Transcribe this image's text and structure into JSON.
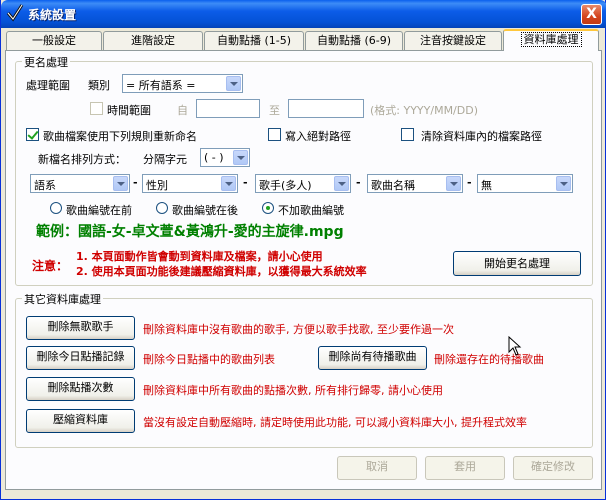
{
  "window": {
    "title": "系統設置",
    "close_label": "X"
  },
  "tabs": [
    {
      "label": "一般設定"
    },
    {
      "label": "進階設定"
    },
    {
      "label": "自動點播 (1-5)"
    },
    {
      "label": "自動點播 (6-9)"
    },
    {
      "label": "注音按鍵設定"
    },
    {
      "label": "資料庫處理"
    }
  ],
  "rename_group": {
    "title": "更名處理",
    "scope_label": "處理範圍",
    "category_label": "類別",
    "category_value": "= 所有語系 =",
    "time_range_label": "時間範圍",
    "from_label": "自",
    "to_label": "至",
    "from_value": "",
    "to_value": "",
    "format_hint": "(格式: YYYY/MM/DD)",
    "rename_rule_label": "歌曲檔案使用下列規則重新命名",
    "absolute_path_label": "寫入絕對路徑",
    "clear_path_label": "清除資料庫內的檔案路徑",
    "order_label": "新檔名排列方式：",
    "separator_label": "分隔字元",
    "separator_value": "( - )",
    "fields": [
      "語系",
      "性別",
      "歌手(多人)",
      "歌曲名稱",
      "無"
    ],
    "dash": "-",
    "number_options": [
      "歌曲編號在前",
      "歌曲編號在後",
      "不加歌曲編號"
    ],
    "example": "範例：國語-女-卓文萱&黃鴻升-愛的主旋律.mpg",
    "notice_label": "注意：",
    "notice_lines": [
      "1. 本頁面動作皆會動到資料庫及檔案，請小心使用",
      "2. 使用本頁面功能後建議壓縮資料庫，以獲得最大系統效率"
    ],
    "start_button": "開始更名處理"
  },
  "other_group": {
    "title": "其它資料庫處理",
    "delete_no_song_singer_button": "刪除無歌歌手",
    "delete_no_song_singer_desc": "刪除資料庫中沒有歌曲的歌手, 方便以歌手找歌, 至少要作過一次",
    "delete_today_records_button": "刪除今日點播記錄",
    "delete_today_records_desc": "刪除今日點播中的歌曲列表",
    "delete_pending_button": "刪除尚有待播歌曲",
    "delete_pending_desc": "刪除還存在的待播歌曲",
    "delete_play_count_button": "刪除點播次數",
    "delete_play_count_desc": "刪除資料庫中所有歌曲的點播次數, 所有排行歸零, 請小心使用",
    "compress_button": "壓縮資料庫",
    "compress_desc": "當沒有設定自動壓縮時, 請定時使用此功能, 可以減小資料庫大小, 提升程式效率"
  },
  "footer": {
    "cancel": "取消",
    "apply": "套用",
    "confirm": "確定修改"
  },
  "colors": {
    "title_bar": "#0451D5",
    "warning_red": "#D00000",
    "example_green": "#008000"
  }
}
